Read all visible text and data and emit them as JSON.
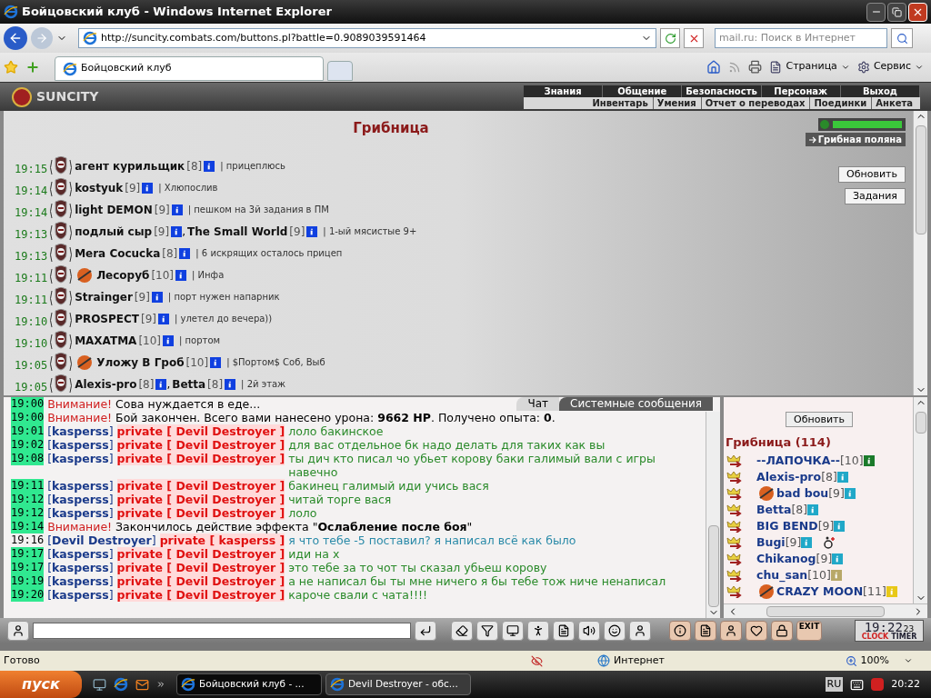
{
  "window": {
    "title": "Бойцовский клуб - Windows Internet Explorer"
  },
  "address_bar": {
    "url": "http://suncity.combats.com/buttons.pl?battle=0.9089039591464",
    "search_placeholder": "mail.ru: Поиск в Интернет"
  },
  "tabs": [
    {
      "label": "Бойцовский клуб",
      "selected": true
    }
  ],
  "command_bar": [
    {
      "label": "Страница"
    },
    {
      "label": "Сервис"
    }
  ],
  "game": {
    "logo": "SUNCITY",
    "main_menu": [
      "Знания",
      "Общение",
      "Безопасность",
      "Персонаж",
      "Выход"
    ],
    "sub_menu": [
      "Инвентарь",
      "Умения",
      "Отчет о переводах",
      "Поединки",
      "Анкета"
    ],
    "room": {
      "title": "Грибница",
      "location": "Грибная поляна",
      "buttons": [
        "Обновить",
        "Задания"
      ],
      "lines": [
        {
          "time": "19:15",
          "users": [
            {
              "name": "агент курильщик",
              "level": "[8]",
              "emblem": false
            }
          ],
          "note": "| прицеплюсь"
        },
        {
          "time": "19:14",
          "users": [
            {
              "name": "kostyuk",
              "level": "[9]",
              "emblem": false
            }
          ],
          "note": "| Хлюпослив"
        },
        {
          "time": "19:14",
          "users": [
            {
              "name": "light DEMON",
              "level": "[9]",
              "emblem": false
            }
          ],
          "note": "| пешком на 3й задания в ПМ"
        },
        {
          "time": "19:13",
          "users": [
            {
              "name": "подлый сыр",
              "level": "[9]",
              "emblem": false
            },
            {
              "name": "The Small World",
              "level": "[9]",
              "emblem": false,
              "joiner": ","
            }
          ],
          "note": "| 1-ый мясистые 9+"
        },
        {
          "time": "19:13",
          "users": [
            {
              "name": "Mera Cocucka",
              "level": "[8]",
              "emblem": false
            }
          ],
          "note": "| 6 искрящих осталось прицеп"
        },
        {
          "time": "19:11",
          "users": [
            {
              "name": "Лесоруб",
              "level": "[10]",
              "emblem": true
            }
          ],
          "note": "| Инфа"
        },
        {
          "time": "19:11",
          "users": [
            {
              "name": "Strainger",
              "level": "[9]",
              "emblem": false
            }
          ],
          "note": "| порт нужен напарник"
        },
        {
          "time": "19:10",
          "users": [
            {
              "name": "PROSPECT",
              "level": "[9]",
              "emblem": false
            }
          ],
          "note": "| улетел до вечера))"
        },
        {
          "time": "19:10",
          "users": [
            {
              "name": "MAXATMA",
              "level": "[10]",
              "emblem": false
            }
          ],
          "note": "| портом"
        },
        {
          "time": "19:05",
          "users": [
            {
              "name": "Уложу В Гроб",
              "level": "[10]",
              "emblem": true
            }
          ],
          "note": "| $Портом$ Соб, Выб"
        },
        {
          "time": "19:05",
          "users": [
            {
              "name": "Alexis-pro",
              "level": "[8]",
              "emblem": false
            },
            {
              "name": "Betta",
              "level": "[8]",
              "emblem": false,
              "joiner": ","
            }
          ],
          "note": "| 2й этаж"
        }
      ]
    },
    "chat_tabs": [
      {
        "label": "Чат",
        "selected": true
      },
      {
        "label": "Системные сообщения",
        "selected": false
      }
    ],
    "chat": [
      {
        "kind": "system",
        "time": "19:00",
        "highlight": true,
        "label": "Внимание!",
        "text": "Сова нуждается в еде..."
      },
      {
        "kind": "system",
        "time": "19:00",
        "highlight": true,
        "label": "Внимание!",
        "text": "Бой закончен. Всего вами нанесено урона: **9662 HP**. Получено опыта: **0**."
      },
      {
        "kind": "private",
        "time": "19:01",
        "highlight": true,
        "from": "[**kasperss**]",
        "to": "private [ Devil Destroyer ]",
        "text": "лоло бакинское",
        "outgoing": false
      },
      {
        "kind": "private",
        "time": "19:02",
        "highlight": true,
        "from": "[**kasperss**]",
        "to": "private [ Devil Destroyer ]",
        "text": "для вас отдельное бк надо делать для таких как вы",
        "outgoing": false
      },
      {
        "kind": "private",
        "time": "19:08",
        "highlight": true,
        "from": "[**kasperss**]",
        "to": "private [ Devil Destroyer ]",
        "text": "ты дич кто писал чо убьет корову баки галимый вали с игры навечно",
        "outgoing": false
      },
      {
        "kind": "private",
        "time": "19:11",
        "highlight": true,
        "from": "[**kasperss**]",
        "to": "private [ Devil Destroyer ]",
        "text": "бакинец галимый иди учись вася",
        "outgoing": false
      },
      {
        "kind": "private",
        "time": "19:12",
        "highlight": true,
        "from": "[**kasperss**]",
        "to": "private [ Devil Destroyer ]",
        "text": "читай торге вася",
        "outgoing": false
      },
      {
        "kind": "private",
        "time": "19:12",
        "highlight": true,
        "from": "[**kasperss**]",
        "to": "private [ Devil Destroyer ]",
        "text": "лоло",
        "outgoing": false
      },
      {
        "kind": "system",
        "time": "19:14",
        "highlight": true,
        "label": "Внимание!",
        "text": "Закончилось действие эффекта \"**Ослабление после боя**\""
      },
      {
        "kind": "private",
        "time": "19:16",
        "highlight": false,
        "from": "[**Devil Destroyer**]",
        "to": "private [ kasperss ]",
        "text": "я что тебе -5 поставил? я написал всё как было",
        "outgoing": true
      },
      {
        "kind": "private",
        "time": "19:17",
        "highlight": true,
        "from": "[**kasperss**]",
        "to": "private [ Devil Destroyer ]",
        "text": "иди на х",
        "outgoing": false
      },
      {
        "kind": "private",
        "time": "19:17",
        "highlight": true,
        "from": "[**kasperss**]",
        "to": "private [ Devil Destroyer ]",
        "text": "это тебе за то чот ты сказал убьеш корову",
        "outgoing": false
      },
      {
        "kind": "private",
        "time": "19:19",
        "highlight": true,
        "from": "[**kasperss**]",
        "to": "private [ Devil Destroyer ]",
        "text": "а не написал бы ты мне ничего я бы тебе тож ниче ненаписал",
        "outgoing": false
      },
      {
        "kind": "private",
        "time": "19:20",
        "highlight": true,
        "from": "[**kasperss**]",
        "to": "private [ Devil Destroyer ]",
        "text": "кароче свали с чата!!!!",
        "outgoing": false
      }
    ],
    "online": {
      "refresh": "Обновить",
      "title": "Грибница (114)",
      "users": [
        {
          "name": "--ЛАПОЧКА--",
          "level": "[10]",
          "color": "#1a7a2a",
          "emblem": false,
          "injured": false
        },
        {
          "name": "Alexis-pro",
          "level": "[8]",
          "color": "#20a8c8",
          "emblem": false,
          "injured": false
        },
        {
          "name": "bad bou",
          "level": "[9]",
          "color": "#20a8c8",
          "emblem": true,
          "injured": false
        },
        {
          "name": "Betta",
          "level": "[8]",
          "color": "#20a8c8",
          "emblem": false,
          "injured": false
        },
        {
          "name": "BIG BEND",
          "level": "[9]",
          "color": "#20a8c8",
          "emblem": false,
          "injured": false
        },
        {
          "name": "Bugi",
          "level": "[9]",
          "color": "#20a8c8",
          "emblem": false,
          "injured": true
        },
        {
          "name": "Chikanog",
          "level": "[9]",
          "color": "#20a8c8",
          "emblem": false,
          "injured": false
        },
        {
          "name": "chu_san",
          "level": "[10]",
          "color": "#b8a868",
          "emblem": false,
          "injured": false
        },
        {
          "name": "CRAZY MOON",
          "level": "[11]",
          "color": "#e8c818",
          "emblem": true,
          "injured": false
        }
      ]
    },
    "toolbar": {
      "exit_label": "EXIT",
      "clock": "19:22",
      "seconds": "23",
      "clock_label": "CLOCK",
      "timer_label": "TIMER"
    }
  },
  "status_bar": {
    "text": "Готово",
    "zone": "Интернет",
    "zoom": "100%"
  },
  "taskbar": {
    "start": "пуск",
    "tasks": [
      {
        "label": "Бойцовский клуб - ...",
        "selected": true
      },
      {
        "label": "Devil Destroyer - обс...",
        "selected": false
      }
    ],
    "language": "RU",
    "time": "20:22"
  }
}
